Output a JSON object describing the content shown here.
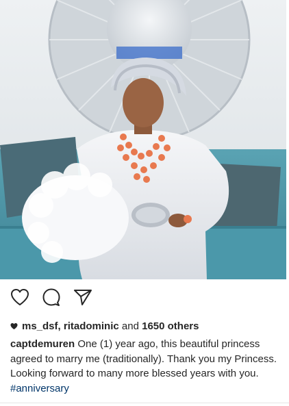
{
  "post": {
    "likes": {
      "user1": "ms_dsf",
      "separator": ",",
      "user2": "ritadominic",
      "and_text": "and",
      "others": "1650 others"
    },
    "caption": {
      "username": "captdemuren",
      "text": "One (1) year ago, this beautiful princess agreed to marry me (traditionally). Thank you my Princess. Looking forward to many more blessed years with you.",
      "hashtag": "#anniversary"
    }
  },
  "icons": {
    "like": "heart-outline-icon",
    "comment": "comment-bubble-icon",
    "share": "paper-plane-icon",
    "likes_marker": "heart-filled-icon"
  },
  "colors": {
    "text": "#262626",
    "hashtag": "#003569",
    "icon_stroke": "#262626"
  }
}
